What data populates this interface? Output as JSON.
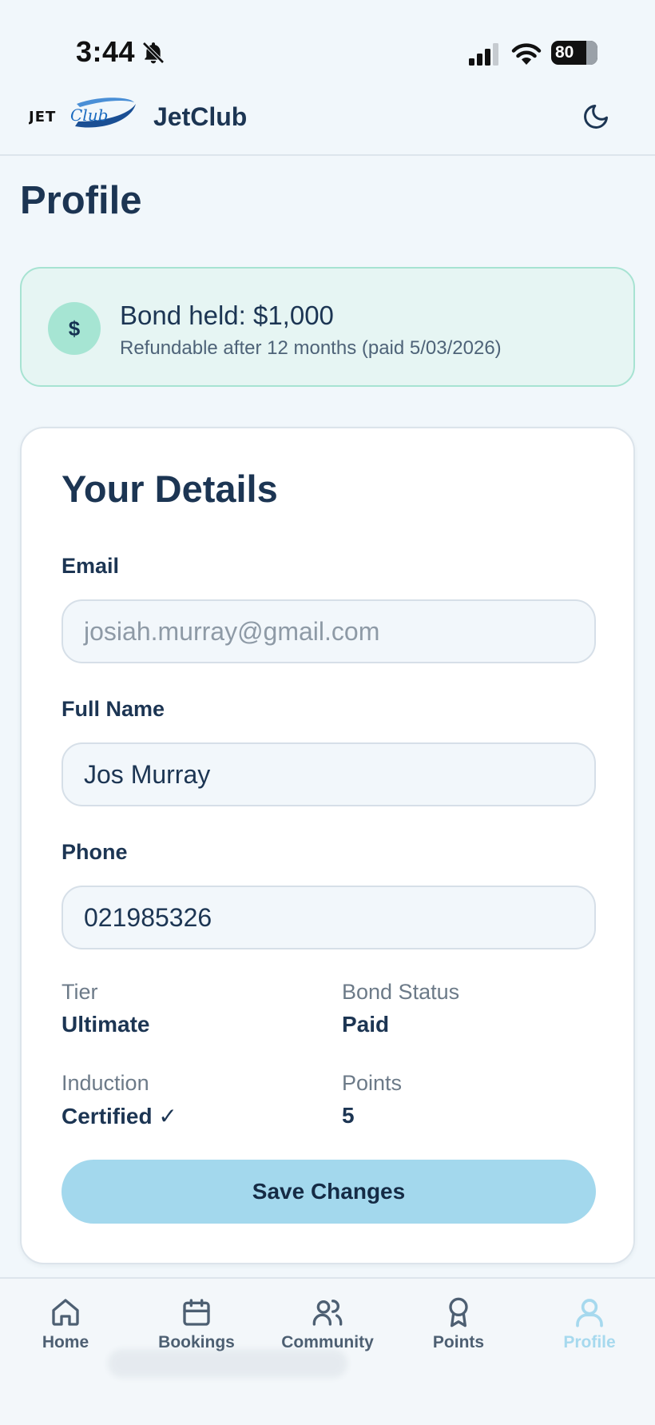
{
  "status_bar": {
    "time": "3:44",
    "battery": "80"
  },
  "header": {
    "logo_text": "JET Club",
    "app_name": "JetClub"
  },
  "page_title": "Profile",
  "bond_banner": {
    "icon_symbol": "$",
    "title": "Bond held: $1,000",
    "subtitle": "Refundable after 12 months (paid 5/03/2026)"
  },
  "details": {
    "title": "Your Details",
    "email_label": "Email",
    "email_value": "josiah.murray@gmail.com",
    "name_label": "Full Name",
    "name_value": "Jos Murray",
    "phone_label": "Phone",
    "phone_value": "021985326",
    "tier_label": "Tier",
    "tier_value": "Ultimate",
    "bond_status_label": "Bond Status",
    "bond_status_value": "Paid",
    "induction_label": "Induction",
    "induction_value": "Certified ✓",
    "points_label": "Points",
    "points_value": "5",
    "save_label": "Save Changes"
  },
  "nav": {
    "items": [
      {
        "label": "Home",
        "icon": "home-icon"
      },
      {
        "label": "Bookings",
        "icon": "calendar-icon"
      },
      {
        "label": "Community",
        "icon": "users-icon"
      },
      {
        "label": "Points",
        "icon": "award-icon"
      },
      {
        "label": "Profile",
        "icon": "user-icon",
        "active": true
      }
    ]
  },
  "colors": {
    "primary_text": "#1c3553",
    "accent": "#a3d8ed",
    "bond_bg": "#e6f5f3",
    "bond_border": "#a7e3d2",
    "active_nav": "#a6d9ee"
  }
}
